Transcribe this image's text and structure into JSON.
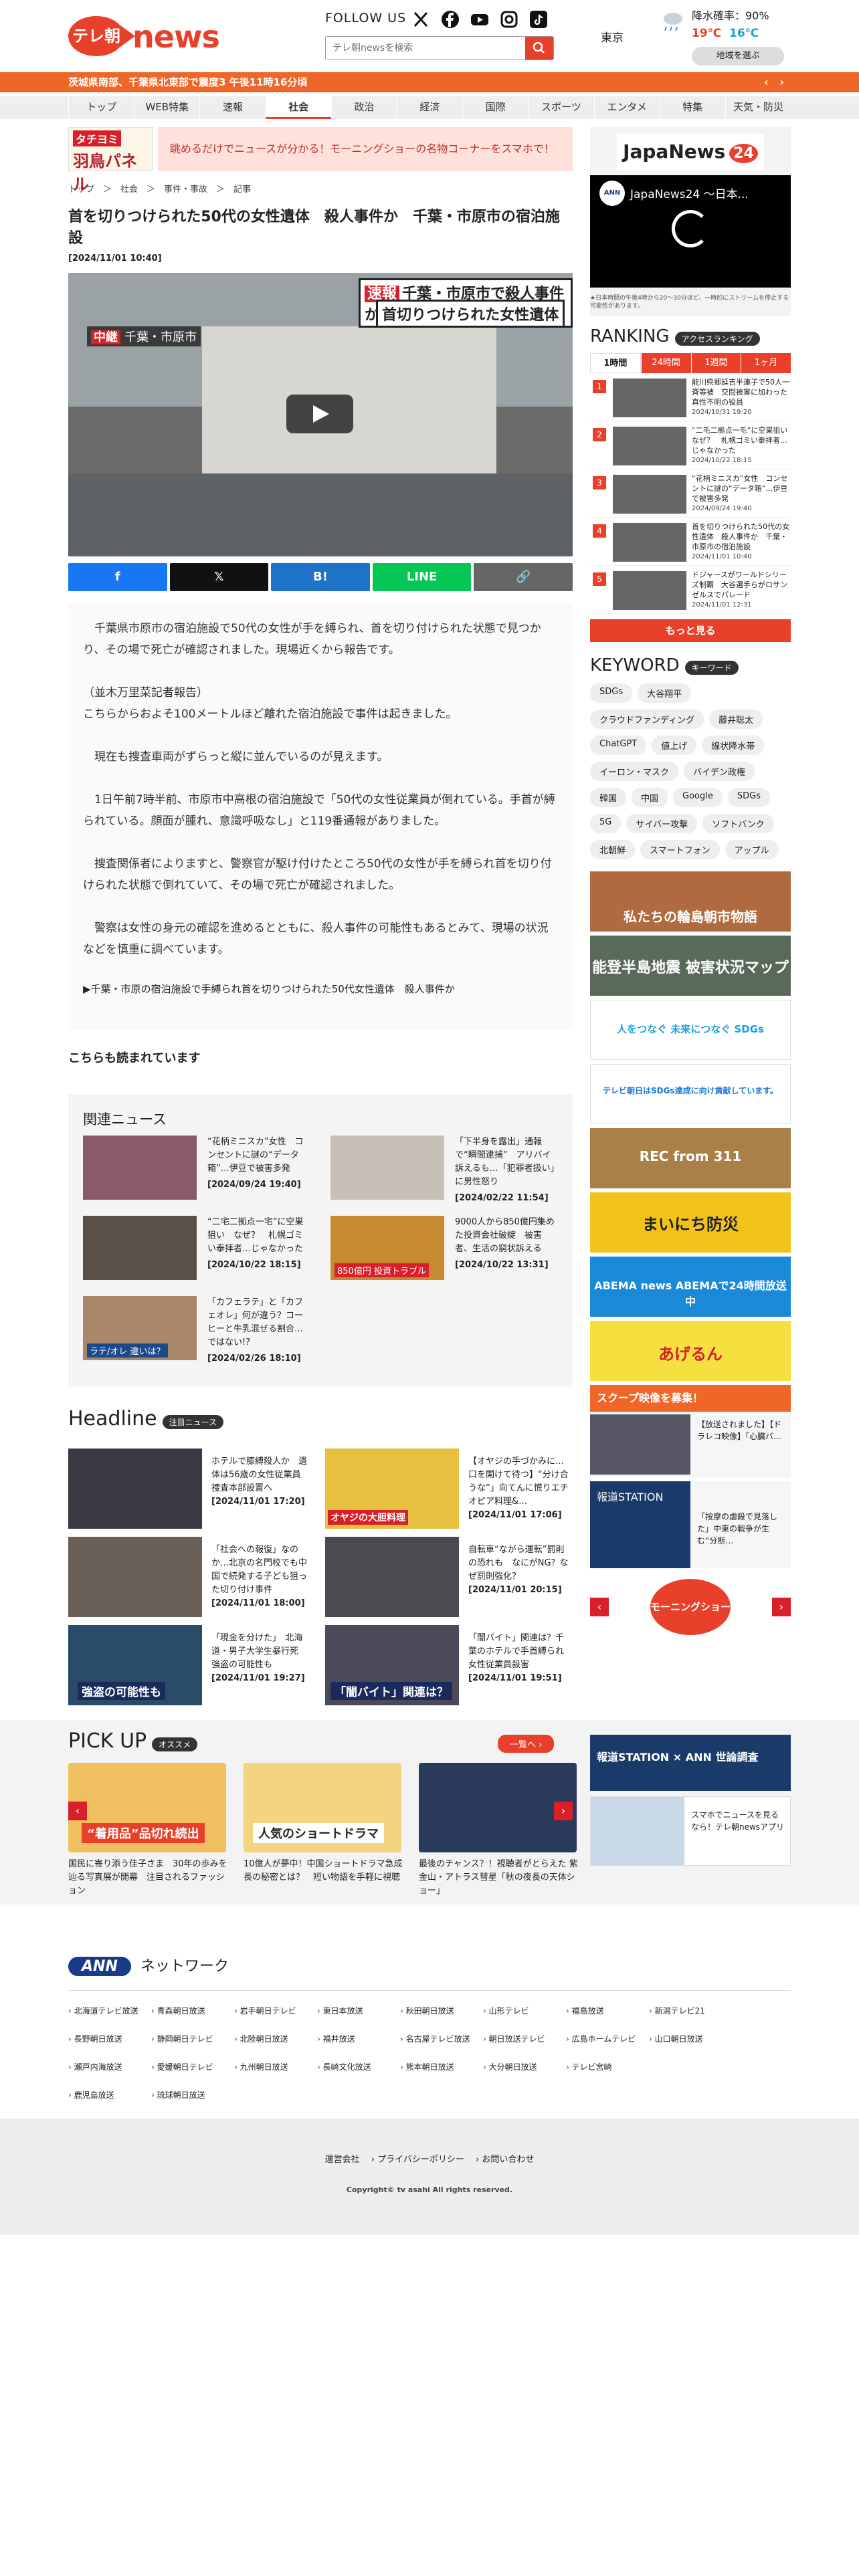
{
  "header": {
    "logo_badge": "テレ朝",
    "logo_word": "news",
    "follow": "FOLLOW US",
    "search_placeholder": "テレ朝newsを検索",
    "weather": {
      "city": "東京",
      "rain": "降水確率：90%",
      "hi": "19℃",
      "lo": "16℃",
      "region_btn": "地域を選ぶ"
    }
  },
  "breaking": "茨城県南部、千葉県北東部で震度3 午後11時16分頃",
  "nav": [
    "トップ",
    "WEB特集",
    "速報",
    "社会",
    "政治",
    "経済",
    "国際",
    "スポーツ",
    "エンタメ",
    "特集",
    "天気・防災"
  ],
  "promo": {
    "tag": "タチヨミ",
    "name": "羽鳥パネル",
    "text": "眺めるだけでニュースが分かる！モーニングショーの名物コーナーをスマホで！"
  },
  "breadcrumb": "トップ　＞　社会　＞　事件・事故　＞　記事",
  "article": {
    "title": "首を切りつけられた50代の女性遺体　殺人事件か　千葉・市原市の宿泊施設",
    "date": "[2024/11/01 10:40]",
    "video": {
      "cap_tag": "速報",
      "cap1": "千葉・市原市で殺人事件か",
      "cap2": "首切りつけられた女性遺体",
      "loc_tag": "中継",
      "loc": "千葉・市原市"
    },
    "share": [
      "f",
      "𝕏",
      "B!",
      "LINE",
      "🔗"
    ],
    "paragraphs": [
      "　千葉県市原市の宿泊施設で50代の女性が手を縛られ、首を切り付けられた状態で見つかり、その場で死亡が確認されました。現場近くから報告です。",
      "（並木万里菜記者報告）\nこちらからおよそ100メートルほど離れた宿泊施設で事件は起きました。",
      "　現在も捜査車両がずらっと縦に並んでいるのが見えます。",
      "　1日午前7時半前、市原市中高根の宿泊施設で「50代の女性従業員が倒れている。手首が縛られている。顔面が腫れ、意識呼吸なし」と119番通報がありました。",
      "　捜査関係者によりますと、警察官が駆け付けたところ50代の女性が手を縛られ首を切り付けられた状態で倒れていて、その場で死亡が確認されました。",
      "　警察は女性の身元の確認を進めるとともに、殺人事件の可能性もあるとみて、現場の状況などを慎重に調べています。"
    ],
    "bottom_link": "▶千葉・市原の宿泊施設で手縛られ首を切りつけられた50代女性遺体　殺人事件か"
  },
  "also_read": "こちらも読まれています",
  "related": {
    "title": "関連ニュース",
    "items": [
      {
        "text": "“花柄ミニスカ”女性　コンセントに謎の“データ箱”…伊豆で被害多発",
        "date": "[2024/09/24 19:40]"
      },
      {
        "text": "「下半身を露出」通報で“瞬間逮捕”　アリバイ訴えるも…「犯罪者扱い」に男性怒り",
        "date": "[2024/02/22 11:54]"
      },
      {
        "text": "“二宅二拠点一宅”に空巣狙い　なぜ？　札幌ゴミい泰拝者…じゃなかった",
        "date": "[2024/10/22 18:15]"
      },
      {
        "text": "9000人から850億円集めた投資会社破綻　被害者、生活の窮状訴える",
        "date": "[2024/10/22 13:31]"
      },
      {
        "text": "「カフェラテ」と「カフェオレ」何が違う？コーヒーと牛乳混ぜる割合…ではない!?",
        "date": "[2024/02/26 18:10]"
      }
    ],
    "thumb_labels": [
      "850億円 投資トラブル",
      "ラテ/オレ 違いは？"
    ]
  },
  "headline": {
    "title": "Headline",
    "pill": "注目ニュース",
    "items": [
      {
        "text": "ホテルで膝縛殺人か　遺体は56歳の女性従業員　捜査本部設置へ",
        "date": "[2024/11/01 17:20]"
      },
      {
        "text": "【オヤジの手づかみに…口を開けて待つ】“分け合うな”」向てんに慌りエチオピア料理&…",
        "date": "[2024/11/01 17:06]"
      },
      {
        "text": "「社会への報復」なのか…北京の名門校でも中国で続発する子ども狙った切り付け事件",
        "date": "[2024/11/01 18:00]"
      },
      {
        "text": "自転車“ながら運転”罰則の恐れも　なにがNG？なぜ罰則強化？",
        "date": "[2024/11/01 20:15]"
      },
      {
        "text": "「現金を分けた」　北海道・男子大学生暴行死　強盗の可能性も",
        "date": "[2024/11/01 19:27]"
      },
      {
        "text": "「闇バイト」関連は？千葉のホテルで手首縛られ女性従業員殺害",
        "date": "[2024/11/01 19:51]"
      }
    ],
    "thumb_labels": [
      "オヤジの大胆料理",
      "強盗の可能性も",
      "「闇バイト」関連は？"
    ]
  },
  "pickup": {
    "title": "PICK UP",
    "pill": "オススメ",
    "all": "一覧へ ›",
    "items": [
      {
        "label": "“着用品”品切れ続出",
        "text": "国民に寄り添う佳子さま　30年の歩みを辿る写真展が開幕　注目されるファッション"
      },
      {
        "label": "人気のショートドラマ",
        "text": "10億人が夢中！中国ショートドラマ急成長の秘密とは？　短い物語を手軽に視聴"
      },
      {
        "label": "",
        "text": "最後のチャンス？！視聴者がとらえた 紫金山・アトラス彗星「秋の夜長の天体ショー」"
      }
    ]
  },
  "side": {
    "japan": {
      "name": "JapaNews",
      "num": "24",
      "video_title": "JapaNews24 ～日本...",
      "badge": "ANN",
      "note": "★日本時間の午後4時から20～30分ほど、一時的にストリームを停止する可能性があります。"
    },
    "ranking": {
      "title": "RANKING",
      "pill": "アクセスランキング",
      "tabs": [
        "1時間",
        "24時間",
        "1週間",
        "1ヶ月"
      ],
      "items": [
        {
          "n": "1",
          "text": "能川県郷延吉半連子で50人一斉等被　交問被害に加わった真性不明の役員",
          "date": "2024/10/31 19:20"
        },
        {
          "n": "2",
          "text": "“二毛二拠点一毛”に空巣狙い　なぜ？　札幌ゴミい泰拝者…じゃなかった",
          "date": "2024/10/22 18:15"
        },
        {
          "n": "3",
          "text": "“花柄ミニスカ”女性　コンセントに謎の“データ箱”…伊豆で被害多発",
          "date": "2024/09/24 19:40"
        },
        {
          "n": "4",
          "text": "首を切りつけられた50代の女性遺体　殺人事件か　千葉・市原市の宿泊施設",
          "date": "2024/11/01 10:40"
        },
        {
          "n": "5",
          "text": "ドジャースがワールドシリーズ制覇　大谷選手らがロサンゼルスでパレード",
          "date": "2024/11/01 12:31"
        }
      ],
      "more": "もっと見る"
    },
    "keyword": {
      "title": "KEYWORD",
      "pill": "キーワード",
      "tags": [
        "SDGs",
        "大谷翔平",
        "クラウドファンディング",
        "藤井聡太",
        "ChatGPT",
        "値上げ",
        "線状降水帯",
        "イーロン・マスク",
        "バイデン政権",
        "韓国",
        "中国",
        "Google",
        "SDGs",
        "5G",
        "サイバー攻撃",
        "ソフトバンク",
        "北朝鮮",
        "スマートフォン",
        "アップル"
      ]
    },
    "banners": [
      "私たちの輪島朝市物語",
      "能登半島地震 被害状況マップ",
      "人をつなぐ 未来につなぐ SDGs",
      "テレビ朝日はSDGs達成に向け貢献しています。",
      "REC from 311",
      "まいにち防災",
      "ABEMA news ABEMAで24時間放送中",
      "あげるん",
      "スクープ映像を募集！"
    ],
    "scoop": {
      "text": "【放送されました】【ドラレコ映像】「心臓バ…"
    },
    "station": {
      "label": "報道STATION",
      "text": "「按摩の虐殺で見落した」中東の戦争が生む“分断…"
    },
    "morning": "モーニングショー",
    "poll": {
      "label": "報道STATION × ANN 世論調査"
    },
    "app": {
      "text": "スマホでニュースを見るなら！テレ朝newsアプリ"
    }
  },
  "footer": {
    "ann": "ANN",
    "network": "ネットワーク",
    "stations": [
      "北海道テレビ放送",
      "青森朝日放送",
      "岩手朝日テレビ",
      "東日本放送",
      "秋田朝日放送",
      "山形テレビ",
      "福島放送",
      "新潟テレビ21",
      "長野朝日放送",
      "静岡朝日テレビ",
      "北陸朝日放送",
      "福井放送",
      "名古屋テレビ放送",
      "朝日放送テレビ",
      "広島ホームテレビ",
      "山口朝日放送",
      "瀬戸内海放送",
      "愛媛朝日テレビ",
      "九州朝日放送",
      "長崎文化放送",
      "熊本朝日放送",
      "大分朝日放送",
      "テレビ宮崎",
      "鹿児島放送",
      "琉球朝日放送"
    ],
    "links": [
      "運営会社",
      "プライバシーポリシー",
      "お問い合わせ"
    ],
    "copyright": "Copyright© tv asahi All rights reserved."
  },
  "colors": {
    "accent": "#e8402a",
    "bar": "#ee6628",
    "ann": "#1a3a8a"
  }
}
